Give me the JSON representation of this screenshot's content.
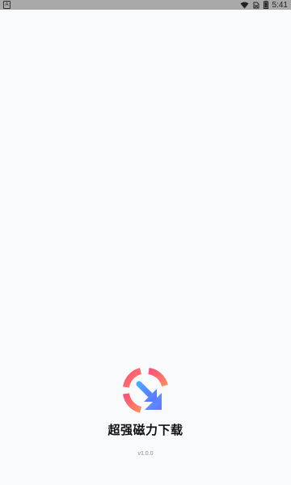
{
  "status_bar": {
    "notification_icon": "a-icon",
    "notification_letter": "A",
    "wifi_icon": "wifi-icon",
    "sim_icon": "sim-icon",
    "battery_icon": "battery-icon",
    "time": "5:41"
  },
  "splash": {
    "logo_icon": "download-arrow-ring-icon",
    "app_name": "超强磁力下载",
    "version": "v1.0.0",
    "colors": {
      "gradient_start": "#ff4f7a",
      "gradient_mid": "#ff8a5c",
      "arrow_start": "#4ea5ff",
      "arrow_end": "#5b6cff"
    }
  }
}
